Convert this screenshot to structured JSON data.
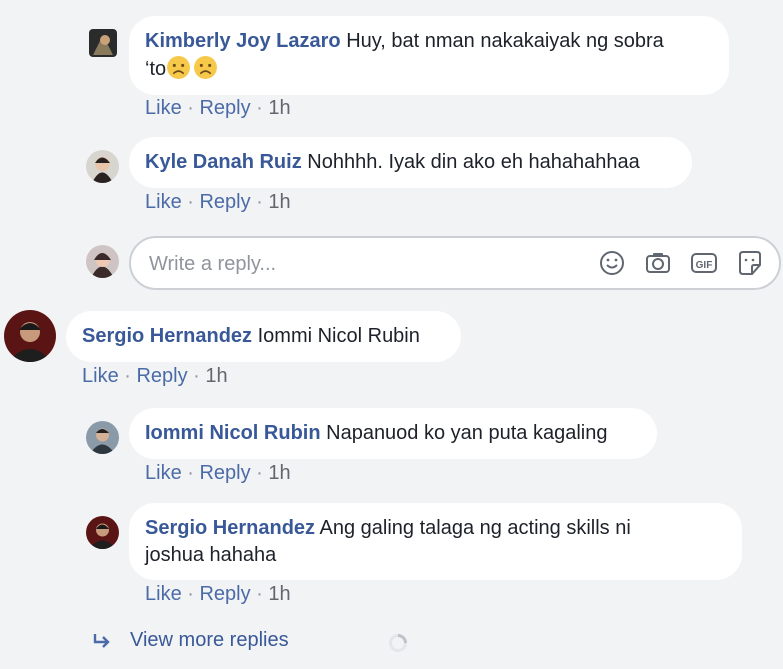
{
  "comments": [
    {
      "author": "Kimberly Joy Lazaro",
      "text_line1": "Huy, bat nman nakakaiyak ng sobra",
      "text_line2": "‘to",
      "emojis": [
        "sad-face-icon",
        "sad-face-icon"
      ],
      "like": "Like",
      "sep1": " · ",
      "reply": "Reply",
      "sep2": " · ",
      "time": "1h"
    },
    {
      "author": "Kyle Danah Ruiz",
      "text": "Nohhhh. Iyak din ako eh hahahahhaa",
      "like": "Like",
      "sep1": " · ",
      "reply": "Reply",
      "sep2": " · ",
      "time": "1h"
    },
    {
      "author": "Sergio Hernandez",
      "text": "Iommi Nicol Rubin",
      "like": "Like",
      "sep1": " · ",
      "reply": "Reply",
      "sep2": " · ",
      "time": "1h"
    },
    {
      "author": "Iommi Nicol Rubin",
      "text": "Napanuod ko yan puta kagaling",
      "like": "Like",
      "sep1": " · ",
      "reply": "Reply",
      "sep2": " · ",
      "time": "1h"
    },
    {
      "author": "Sergio Hernandez",
      "text_line1": "Ang galing talaga ng acting skills ni",
      "text_line2": "joshua hahaha",
      "like": "Like",
      "sep1": " · ",
      "reply": "Reply",
      "sep2": " · ",
      "time": "1h"
    }
  ],
  "reply_box": {
    "placeholder": "Write a reply...",
    "icons": [
      "emoji-icon",
      "camera-icon",
      "gif-icon",
      "sticker-icon"
    ]
  },
  "view_more": {
    "label": "View more replies",
    "icon": "reply-arrow-icon"
  },
  "colors": {
    "background": "#f2f3f5",
    "author": "#385898",
    "link": "#4b6ba7",
    "muted": "#90949c"
  }
}
